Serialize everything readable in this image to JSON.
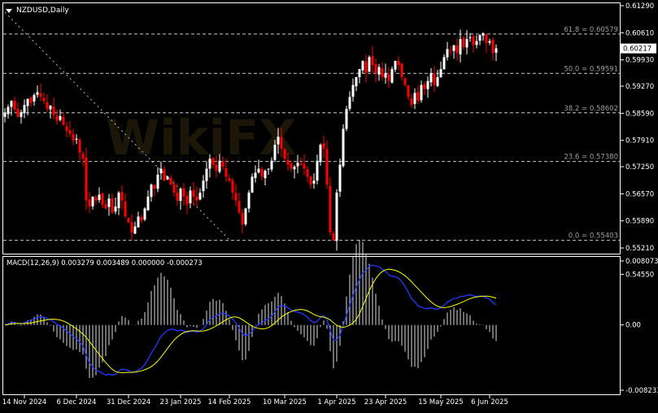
{
  "header": {
    "symbol_timeframe": "NZDUSD,Daily"
  },
  "current_price": "0.60217",
  "price_axis": [
    "0.61290",
    "0.60610",
    "0.59930",
    "0.59270",
    "0.58590",
    "0.57910",
    "0.57250",
    "0.56570",
    "0.55890",
    "0.55210",
    "0.54550"
  ],
  "fibonacci": [
    {
      "label": "61.8 = 0.60579",
      "price": 0.60579
    },
    {
      "label": "50.0 = 0.59591",
      "price": 0.59591
    },
    {
      "label": "38.2 = 0.58602",
      "price": 0.58602
    },
    {
      "label": "23.6 = 0.57380",
      "price": 0.5738
    },
    {
      "label": "0.0 = 0.55403",
      "price": 0.55403
    }
  ],
  "macd": {
    "label": "MACD(12,26,9) 0.003279 0.003489 0.000000 -0.000273",
    "axis": [
      "0.008073",
      "0.00",
      "-0.008233"
    ],
    "range": [
      -0.008233,
      0.008073
    ]
  },
  "time_axis": [
    {
      "label": "14 Nov 2024",
      "index": 6
    },
    {
      "label": "6 Dec 2024",
      "index": 22
    },
    {
      "label": "31 Dec 2024",
      "index": 38
    },
    {
      "label": "23 Jan 2025",
      "index": 54
    },
    {
      "label": "14 Feb 2025",
      "index": 69
    },
    {
      "label": "10 Mar 2025",
      "index": 86
    },
    {
      "label": "1 Apr 2025",
      "index": 102
    },
    {
      "label": "23 Apr 2025",
      "index": 117
    },
    {
      "label": "15 May 2025",
      "index": 134
    },
    {
      "label": "6 Jun 2025",
      "index": 149
    }
  ],
  "colors": {
    "bull": "#ffffff",
    "bear": "#ff0000",
    "macd": "#1e3cff",
    "signal": "#ffff00",
    "grid": "#c8c8c8"
  },
  "chart_data": {
    "type": "candlestick",
    "title": "NZDUSD,Daily",
    "ylim": [
      0.5455,
      0.6129
    ],
    "close": [
      0.586,
      0.5875,
      0.589,
      0.5868,
      0.585,
      0.5862,
      0.588,
      0.5895,
      0.5885,
      0.5905,
      0.5912,
      0.59,
      0.589,
      0.587,
      0.5878,
      0.5855,
      0.584,
      0.5852,
      0.583,
      0.5815,
      0.5808,
      0.579,
      0.5795,
      0.576,
      0.5745,
      0.564,
      0.5625,
      0.565,
      0.564,
      0.5655,
      0.563,
      0.562,
      0.5645,
      0.561,
      0.5625,
      0.566,
      0.564,
      0.56,
      0.5585,
      0.556,
      0.5575,
      0.56,
      0.559,
      0.562,
      0.565,
      0.568,
      0.567,
      0.5705,
      0.572,
      0.569,
      0.57,
      0.568,
      0.566,
      0.564,
      0.567,
      0.565,
      0.563,
      0.5665,
      0.565,
      0.564,
      0.566,
      0.569,
      0.572,
      0.5745,
      0.573,
      0.5715,
      0.574,
      0.5725,
      0.57,
      0.569,
      0.566,
      0.564,
      0.561,
      0.558,
      0.562,
      0.566,
      0.57,
      0.571,
      0.572,
      0.57,
      0.5715,
      0.572,
      0.574,
      0.578,
      0.58,
      0.577,
      0.5745,
      0.573,
      0.572,
      0.5725,
      0.5735,
      0.573,
      0.572,
      0.57,
      0.568,
      0.569,
      0.574,
      0.578,
      0.577,
      0.568,
      0.556,
      0.554,
      0.566,
      0.573,
      0.582,
      0.587,
      0.59,
      0.593,
      0.595,
      0.597,
      0.599,
      0.596,
      0.6,
      0.598,
      0.596,
      0.5975,
      0.595,
      0.596,
      0.594,
      0.597,
      0.599,
      0.598,
      0.595,
      0.593,
      0.59,
      0.588,
      0.591,
      0.589,
      0.593,
      0.592,
      0.594,
      0.596,
      0.593,
      0.595,
      0.597,
      0.6,
      0.602,
      0.6015,
      0.603,
      0.601,
      0.6045,
      0.6025,
      0.6045,
      0.605,
      0.603,
      0.604,
      0.6055,
      0.606,
      0.6035,
      0.604,
      0.601,
      0.6022
    ]
  }
}
